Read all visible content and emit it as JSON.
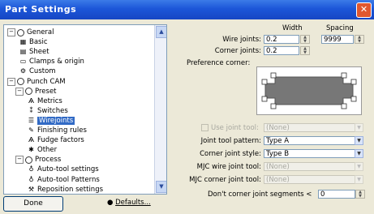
{
  "window": {
    "title": "Part Settings",
    "close": "✕"
  },
  "tree": {
    "nodes": [
      {
        "label": "General",
        "kind": "circle",
        "toggle": "−"
      },
      {
        "label": "Basic",
        "kind": "icon",
        "icon": "grid-icon"
      },
      {
        "label": "Sheet",
        "kind": "icon",
        "icon": "sheet-icon"
      },
      {
        "label": "Clamps & origin",
        "kind": "icon",
        "icon": "clamp-icon"
      },
      {
        "label": "Custom",
        "kind": "icon",
        "icon": "custom-icon"
      },
      {
        "label": "Punch CAM",
        "kind": "circle",
        "toggle": "−"
      },
      {
        "label": "Preset",
        "kind": "circle",
        "toggle": "−"
      },
      {
        "label": "Metrics",
        "kind": "icon",
        "icon": "metrics-icon"
      },
      {
        "label": "Switches",
        "kind": "icon",
        "icon": "switch-icon"
      },
      {
        "label": "Wirejoints",
        "kind": "icon",
        "icon": "wirejoint-icon",
        "selected": true
      },
      {
        "label": "Finishing rules",
        "kind": "icon",
        "icon": "finish-icon"
      },
      {
        "label": "Fudge factors",
        "kind": "icon",
        "icon": "fudge-icon"
      },
      {
        "label": "Other",
        "kind": "icon",
        "icon": "other-icon"
      },
      {
        "label": "Process",
        "kind": "circle",
        "toggle": "−"
      },
      {
        "label": "Auto-tool settings",
        "kind": "icon",
        "icon": "autotool-icon"
      },
      {
        "label": "Auto-tool Patterns",
        "kind": "icon",
        "icon": "pattern-icon"
      },
      {
        "label": "Reposition settings",
        "kind": "icon",
        "icon": "reposition-icon"
      }
    ]
  },
  "buttons": {
    "done": "Done",
    "defaults": "Defaults..."
  },
  "panel": {
    "width_header": "Width",
    "spacing_header": "Spacing",
    "wire_joints_label": "Wire joints:",
    "wire_joints_width": "0.2",
    "wire_joints_spacing": "9999",
    "corner_joints_label": "Corner joints:",
    "corner_joints_width": "0.2",
    "preference_corner_label": "Preference corner:",
    "use_joint_tool_label": "Use joint tool:",
    "use_joint_tool_value": "(None)",
    "joint_tool_pattern_label": "Joint tool pattern:",
    "joint_tool_pattern_value": "Type A",
    "corner_joint_style_label": "Corner joint style:",
    "corner_joint_style_value": "Type B",
    "mjc_wire_label": "MJC wire joint tool:",
    "mjc_wire_value": "(None)",
    "mjc_corner_label": "MJC corner joint tool:",
    "mjc_corner_value": "(None)",
    "dont_corner_label": "Don't corner joint segments <",
    "dont_corner_value": "0"
  },
  "colors": {
    "titlebar": "#1c56d8",
    "selection": "#316ac5",
    "close": "#e0572f"
  }
}
